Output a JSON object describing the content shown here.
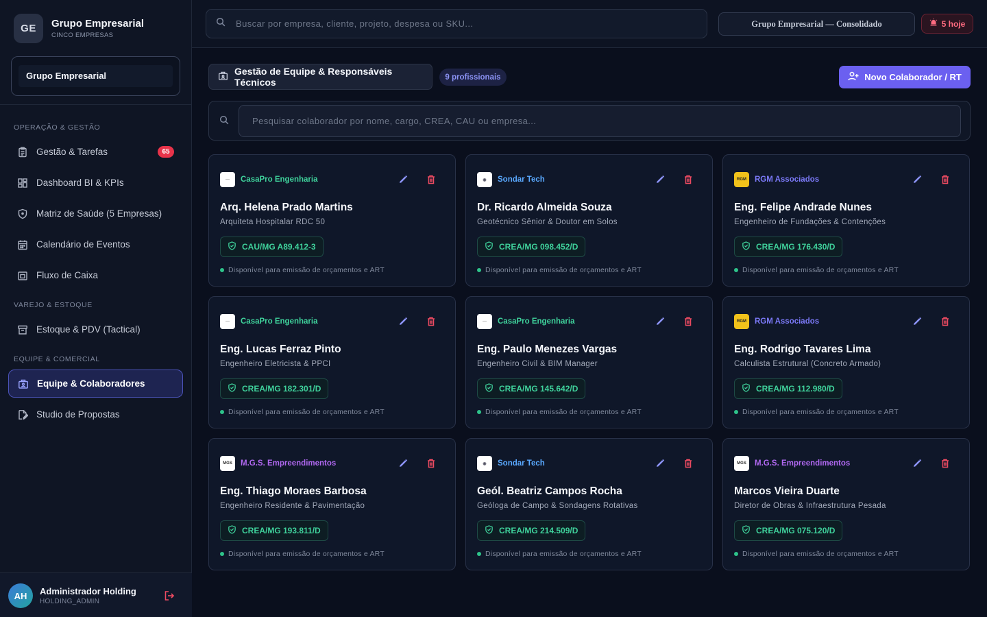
{
  "brand": {
    "initials": "GE",
    "title": "Grupo Empresarial",
    "subtitle": "CINCO EMPRESAS"
  },
  "company_selector": {
    "value": "Grupo Empresarial"
  },
  "sidebar": {
    "sections": [
      {
        "label": "OPERAÇÃO & GESTÃO"
      },
      {
        "label": "VAREJO & ESTOQUE"
      },
      {
        "label": "EQUIPE & COMERCIAL"
      }
    ],
    "items": [
      {
        "label": "Gestão & Tarefas",
        "icon": "clipboard-icon",
        "badge": "65"
      },
      {
        "label": "Dashboard BI & KPIs",
        "icon": "dashboard-icon"
      },
      {
        "label": "Matriz de Saúde (5 Empresas)",
        "icon": "shield-icon"
      },
      {
        "label": "Calendário de Eventos",
        "icon": "calendar-icon"
      },
      {
        "label": "Fluxo de Caixa",
        "icon": "wallet-icon"
      },
      {
        "label": "Estoque & PDV (Tactical)",
        "icon": "archive-icon"
      },
      {
        "label": "Equipe & Colaboradores",
        "icon": "briefcase-icon",
        "active": true
      },
      {
        "label": "Studio de Propostas",
        "icon": "file-edit-icon"
      }
    ]
  },
  "user": {
    "initials": "AH",
    "name": "Administrador Holding",
    "role": "HOLDING_ADMIN"
  },
  "topbar": {
    "search_placeholder": "Buscar por empresa, cliente, projeto, despesa ou SKU...",
    "consolidated_label": "Grupo Empresarial — Consolidado",
    "alerts_label": "5 hoje"
  },
  "main": {
    "title": "Gestão de Equipe & Responsáveis Técnicos",
    "count_label": "9 profissionais",
    "new_button_label": "Novo Colaborador / RT",
    "staff_search_placeholder": "Pesquisar colaborador por nome, cargo, CREA, CAU ou empresa..."
  },
  "colors": {
    "accent": "#6b60f0",
    "casapro": "#3fd19b",
    "sondar": "#5aa9ff",
    "rgm": "#7b79f7",
    "mgs": "#b068f0",
    "danger": "#e8334a",
    "registry": "#3fd19b"
  },
  "cards": [
    {
      "company": "CasaPro Engenharia",
      "company_key": "casapro",
      "name": "Arq. Helena Prado Martins",
      "role": "Arquiteta Hospitalar RDC 50",
      "registry": "CAU/MG A89.412-3",
      "availability": "Disponível para emissão de orçamentos e ART"
    },
    {
      "company": "Sondar Tech",
      "company_key": "sondar",
      "name": "Dr. Ricardo Almeida Souza",
      "role": "Geotécnico Sênior & Doutor em Solos",
      "registry": "CREA/MG 098.452/D",
      "availability": "Disponível para emissão de orçamentos e ART"
    },
    {
      "company": "RGM Associados",
      "company_key": "rgm",
      "name": "Eng. Felipe Andrade Nunes",
      "role": "Engenheiro de Fundações & Contenções",
      "registry": "CREA/MG 176.430/D",
      "availability": "Disponível para emissão de orçamentos e ART"
    },
    {
      "company": "CasaPro Engenharia",
      "company_key": "casapro",
      "name": "Eng. Lucas Ferraz Pinto",
      "role": "Engenheiro Eletricista & PPCI",
      "registry": "CREA/MG 182.301/D",
      "availability": "Disponível para emissão de orçamentos e ART"
    },
    {
      "company": "CasaPro Engenharia",
      "company_key": "casapro",
      "name": "Eng. Paulo Menezes Vargas",
      "role": "Engenheiro Civil & BIM Manager",
      "registry": "CREA/MG 145.642/D",
      "availability": "Disponível para emissão de orçamentos e ART"
    },
    {
      "company": "RGM Associados",
      "company_key": "rgm",
      "name": "Eng. Rodrigo Tavares Lima",
      "role": "Calculista Estrutural (Concreto Armado)",
      "registry": "CREA/MG 112.980/D",
      "availability": "Disponível para emissão de orçamentos e ART"
    },
    {
      "company": "M.G.S. Empreendimentos",
      "company_key": "mgs",
      "name": "Eng. Thiago Moraes Barbosa",
      "role": "Engenheiro Residente & Pavimentação",
      "registry": "CREA/MG 193.811/D",
      "availability": "Disponível para emissão de orçamentos e ART"
    },
    {
      "company": "Sondar Tech",
      "company_key": "sondar",
      "name": "Geól. Beatriz Campos Rocha",
      "role": "Geóloga de Campo & Sondagens Rotativas",
      "registry": "CREA/MG 214.509/D",
      "availability": "Disponível para emissão de orçamentos e ART"
    },
    {
      "company": "M.G.S. Empreendimentos",
      "company_key": "mgs",
      "name": "Marcos Vieira Duarte",
      "role": "Diretor de Obras & Infraestrutura Pesada",
      "registry": "CREA/MG 075.120/D",
      "availability": "Disponível para emissão de orçamentos e ART"
    }
  ]
}
